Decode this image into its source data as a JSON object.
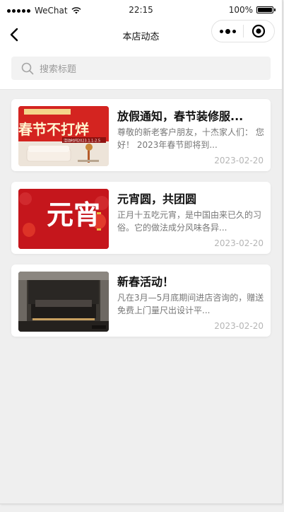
{
  "status_bar": {
    "carrier": "WeChat",
    "time": "22:15",
    "battery": "100%"
  },
  "nav": {
    "title": "本店动态"
  },
  "search": {
    "placeholder": "搜索标题"
  },
  "articles": [
    {
      "title": "放假通知，春节装修服...",
      "summary": "尊敬的新老客户朋友，十杰家人们：  您好！  2023年春节即将到...",
      "date": "2023-02-20",
      "thumb_text": "春节不打烊",
      "thumb_caption": "活动时间2023.1.1-2.5"
    },
    {
      "title": "元宵圆，共团圆",
      "summary": "正月十五吃元宵，是中国由来已久的习俗。它的做法成分风味各异...",
      "date": "2023-02-20",
      "thumb_text": "元宵"
    },
    {
      "title": "新春活动！",
      "summary": "凡在3月—5月底期间进店咨询的，赠送免费上门量尺出设计平...",
      "date": "2023-02-20"
    }
  ],
  "colors": {
    "background": "#efefef",
    "card": "#ffffff",
    "title_text": "#111111",
    "summary_text": "#777777",
    "date_text": "#b5b5b5"
  }
}
